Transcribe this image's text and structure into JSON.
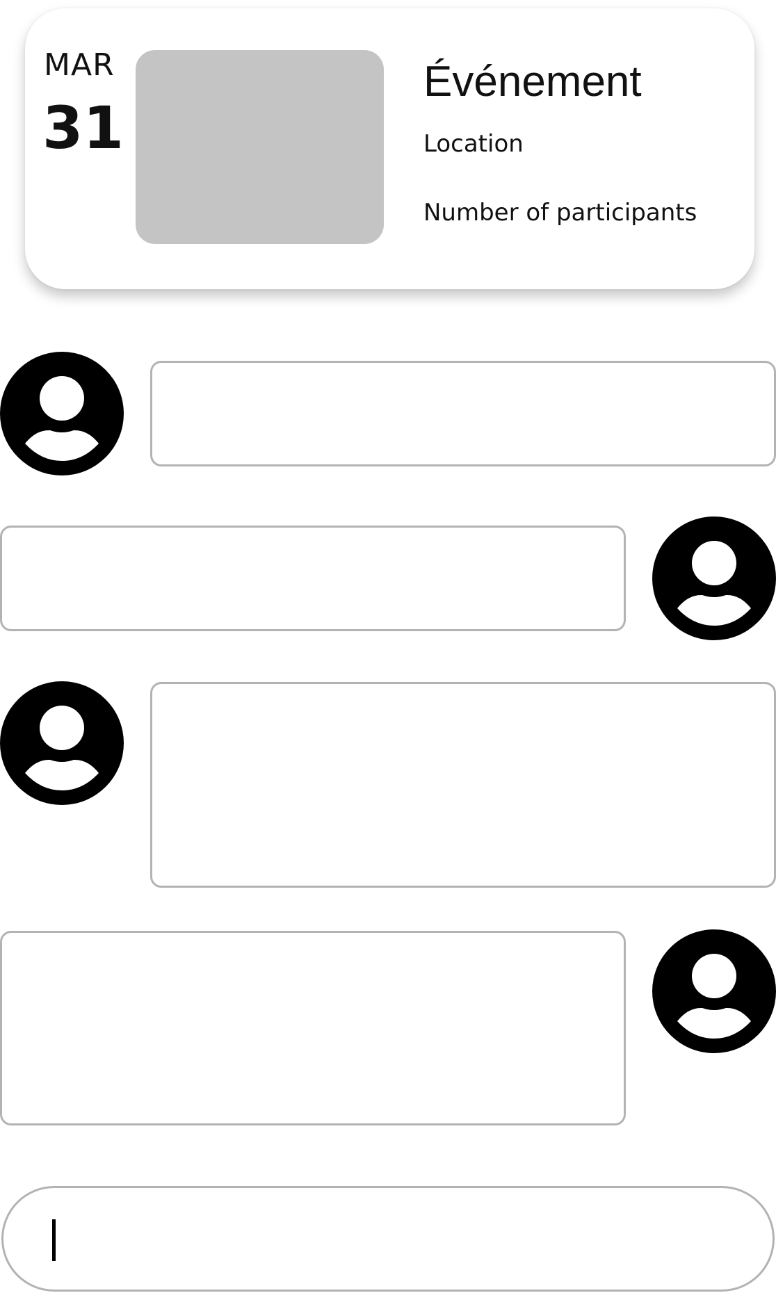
{
  "event": {
    "month": "MAR",
    "day": "31",
    "title": "Événement",
    "location": "Location",
    "participants": "Number of participants"
  },
  "messages": [
    {
      "side": "left",
      "text": ""
    },
    {
      "side": "right",
      "text": ""
    },
    {
      "side": "left",
      "text": ""
    },
    {
      "side": "right",
      "text": ""
    }
  ],
  "composer": {
    "value": "",
    "placeholder": ""
  },
  "icons": {
    "avatar": "account-circle-icon"
  }
}
